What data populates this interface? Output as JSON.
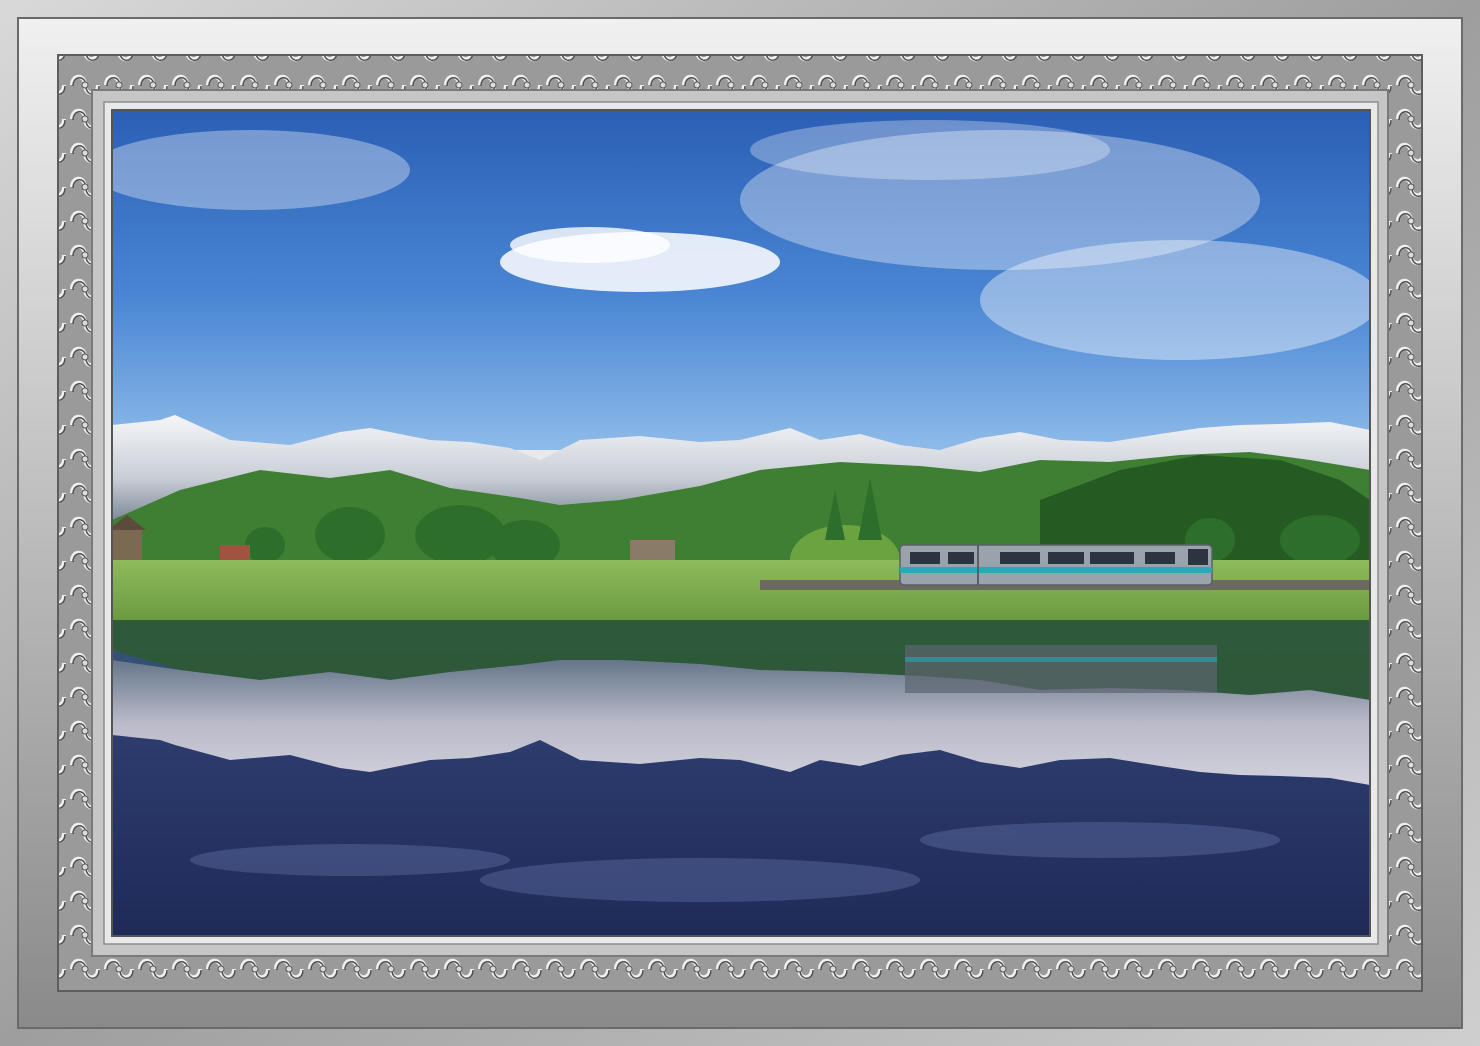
{
  "scene": {
    "subject": "framed-landscape-photo",
    "frame_color": "#b9b9b9",
    "frame_dark": "#6f6f6f",
    "frame_light": "#e6e6e6",
    "sky_top": "#2f63b8",
    "sky_bottom": "#7fb0e6",
    "snow": "#f2f4f8",
    "mountain_shadow": "#7a8797",
    "forest": "#2f6a2a",
    "meadow": "#7fae4c",
    "water": "#24305f",
    "train_body": "#9aa3ab",
    "train_stripe": "#2aa8b8"
  }
}
